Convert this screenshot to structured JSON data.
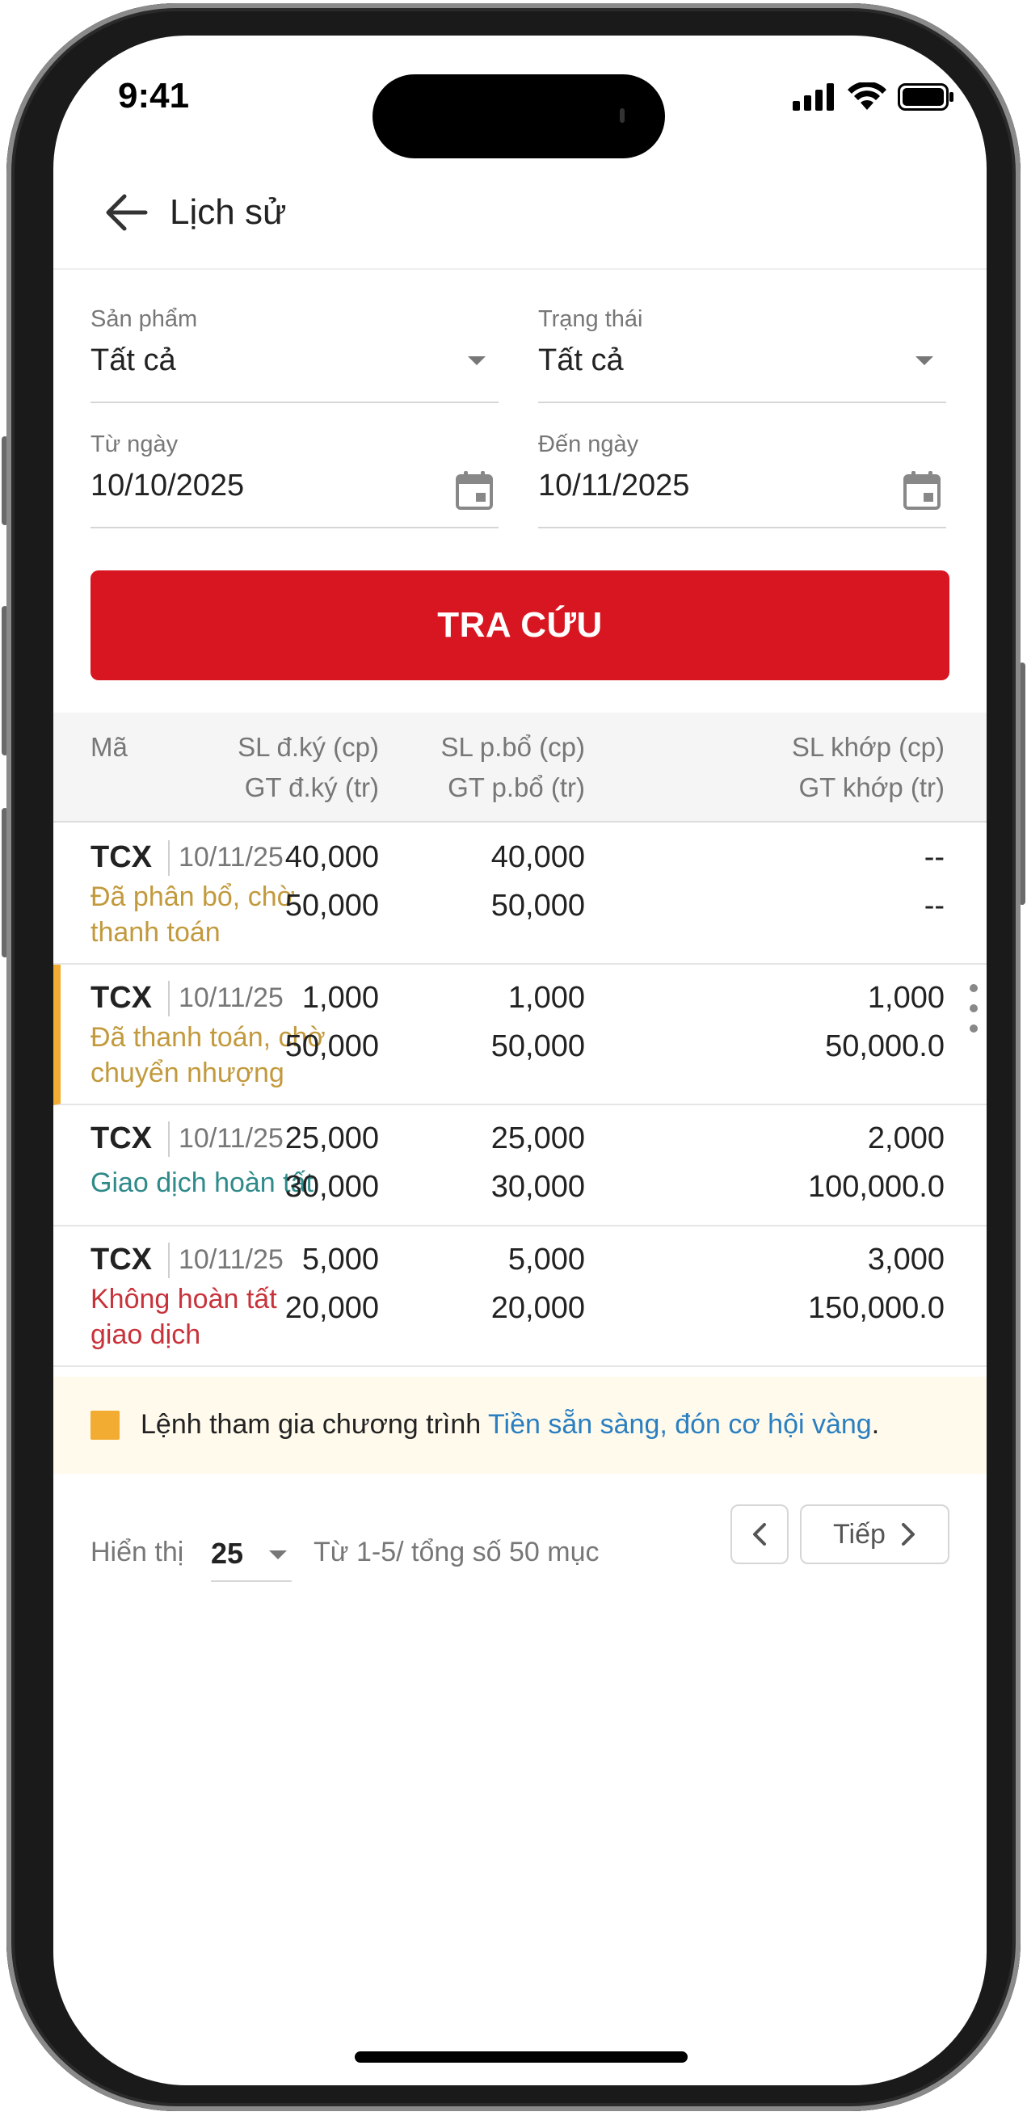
{
  "status_bar": {
    "time": "9:41"
  },
  "header": {
    "title": "Lịch sử",
    "back_icon": "arrow-left-icon"
  },
  "filters": {
    "product": {
      "label": "Sản phẩm",
      "value": "Tất cả"
    },
    "status": {
      "label": "Trạng thái",
      "value": "Tất cả"
    },
    "from_date": {
      "label": "Từ ngày",
      "value": "10/10/2025"
    },
    "to_date": {
      "label": "Đến ngày",
      "value": "10/11/2025"
    }
  },
  "search_button": {
    "label": "TRA CỨU"
  },
  "table": {
    "headers": {
      "code": "Mã",
      "reg_qty": "SL đ.ký (cp)",
      "reg_val": "GT đ.ký (tr)",
      "alloc_qty": "SL p.bổ (cp)",
      "alloc_val": "GT p.bổ (tr)",
      "match_qty": "SL khớp (cp)",
      "match_val": "GT khớp (tr)"
    },
    "rows": [
      {
        "code": "TCX",
        "date": "10/11/25",
        "status_line1": "Đã phân bổ, chờ",
        "status_line2": "thanh toán",
        "status_color": "#c29a3d",
        "reg_qty": "40,000",
        "reg_val": "50,000",
        "alloc_qty": "40,000",
        "alloc_val": "50,000",
        "match_qty": "--",
        "match_val": "--"
      },
      {
        "code": "TCX",
        "date": "10/11/25",
        "status_line1": "Đã thanh toán, chờ",
        "status_line2": "chuyển nhượng",
        "status_color": "#c29a3d",
        "reg_qty": "1,000",
        "reg_val": "50,000",
        "alloc_qty": "1,000",
        "alloc_val": "50,000",
        "match_qty": "1,000",
        "match_val": "50,000.0"
      },
      {
        "code": "TCX",
        "date": "10/11/25",
        "status_line1": "Giao dịch hoàn tất",
        "status_line2": "",
        "status_color": "#2f8a8a",
        "reg_qty": "25,000",
        "reg_val": "30,000",
        "alloc_qty": "25,000",
        "alloc_val": "30,000",
        "match_qty": "2,000",
        "match_val": "100,000.0"
      },
      {
        "code": "TCX",
        "date": "10/11/25",
        "status_line1": "Không hoàn tất",
        "status_line2": "giao dịch",
        "status_color": "#c8323a",
        "reg_qty": "5,000",
        "reg_val": "20,000",
        "alloc_qty": "5,000",
        "alloc_val": "20,000",
        "match_qty": "3,000",
        "match_val": "150,000.0"
      }
    ]
  },
  "note": {
    "text": "Lệnh tham gia chương trình ",
    "link": "Tiền sẵn sàng, đón cơ hội vàng",
    "suffix": ".",
    "marker_color": "#f3ac32"
  },
  "pagination": {
    "show_label": "Hiển thị",
    "page_size": "25",
    "range_text": "Từ 1-5/ tổng số 50 mục",
    "next_label": "Tiếp"
  },
  "colors": {
    "accent": "#d81621",
    "highlight": "#f3ac32",
    "link": "#2a7fc0"
  }
}
